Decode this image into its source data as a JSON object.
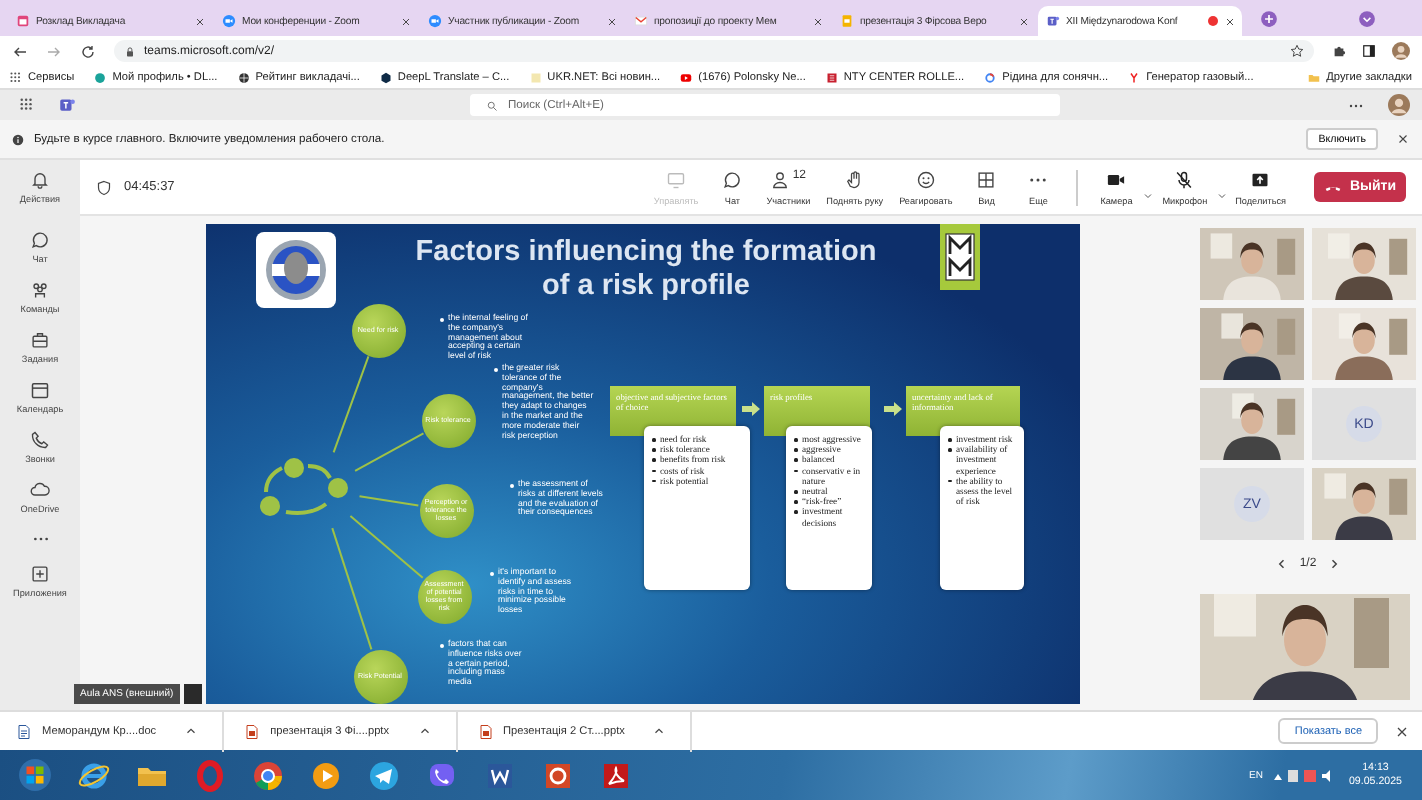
{
  "browser": {
    "tabs": [
      {
        "title": "Розклад Викладача",
        "kind": "calendar",
        "selected": false
      },
      {
        "title": "Мои конференции - Zoom",
        "kind": "zoom",
        "selected": false
      },
      {
        "title": "Участник публикации - Zoom",
        "kind": "zoom",
        "selected": false
      },
      {
        "title": "пропозиції до проекту Мем",
        "kind": "mail",
        "selected": false
      },
      {
        "title": "презентація 3 Фірсова Веро",
        "kind": "slides",
        "selected": false
      },
      {
        "title": "XII Międzynarodowa Konf",
        "kind": "teams",
        "selected": true
      }
    ],
    "url": "teams.microsoft.com/v2/",
    "bookmarks": [
      {
        "title": "Сервисы",
        "kind": "apps"
      },
      {
        "title": "Мой профиль • DL...",
        "kind": "profile"
      },
      {
        "title": "Рейтинг викладачі...",
        "kind": "globe"
      },
      {
        "title": "DeepL Translate – C...",
        "kind": "deepl"
      },
      {
        "title": "UKR.NET: Всі новин...",
        "kind": "ukrnet"
      },
      {
        "title": "(1676) Polonsky Ne...",
        "kind": "youtube"
      },
      {
        "title": "NTY CENTER ROLLE...",
        "kind": "nty"
      },
      {
        "title": "Рідина для сонячн...",
        "kind": "google"
      },
      {
        "title": "Генератор газовый...",
        "kind": "yandex"
      }
    ],
    "other_bookmarks": "Другие закладки"
  },
  "teams": {
    "search": {
      "placeholder": "Поиск (Ctrl+Alt+E)"
    }
  },
  "notice": {
    "text": "Будьте в курсе главного. Включите уведомления рабочего стола.",
    "button": "Включить"
  },
  "rail": [
    {
      "label": "Действия",
      "kind": "bell"
    },
    {
      "label": "Чат",
      "kind": "chat"
    },
    {
      "label": "Команды",
      "kind": "teams"
    },
    {
      "label": "Задания",
      "kind": "bag"
    },
    {
      "label": "Календарь",
      "kind": "calendar"
    },
    {
      "label": "Звонки",
      "kind": "phone"
    },
    {
      "label": "OneDrive",
      "kind": "cloud"
    },
    {
      "kind": "more"
    },
    {
      "label": "Приложения",
      "kind": "apps"
    }
  ],
  "meeting": {
    "timer": "04:45:37",
    "controls": [
      {
        "label": "Управлять",
        "kind": "manage",
        "disabled": true
      },
      {
        "label": "Чат",
        "kind": "chat",
        "disabled": false
      },
      {
        "label": "Участники",
        "kind": "people",
        "count": "12",
        "disabled": false
      },
      {
        "label": "Поднять руку",
        "kind": "hand",
        "disabled": false
      },
      {
        "label": "Реагировать",
        "kind": "react",
        "disabled": false
      },
      {
        "label": "Вид",
        "kind": "view",
        "disabled": false
      },
      {
        "label": "Еще",
        "kind": "more",
        "disabled": false
      },
      {
        "label": "Камера",
        "kind": "camera",
        "disabled": false
      },
      {
        "label": "Микрофон",
        "kind": "mic",
        "disabled": false
      },
      {
        "label": "Поделиться",
        "kind": "share",
        "disabled": false
      }
    ],
    "leave": "Выйти"
  },
  "slide": {
    "title_lines": [
      "Factors influencing the formation",
      "of a risk profile"
    ],
    "factors": [
      {
        "name": "Need for risk",
        "note": "the internal feeling of the company's management about accepting a certain level of risk"
      },
      {
        "name": "Risk tolerance",
        "note": "the greater risk tolerance of the company's management, the better they adapt to changes in the market and the more moderate their risk perception"
      },
      {
        "name": "Perception or tolerance the losses",
        "note": "the assessment of risks at different levels and the evaluation of their consequences"
      },
      {
        "name": "Assessment of potential losses from risk",
        "note": "it's important to identify and assess risks in time to minimize possible losses"
      },
      {
        "name": "Risk Potential",
        "note": "factors that can influence risks over a certain period, including mass media"
      }
    ],
    "steps": [
      {
        "header": "objective and subjective factors of choice",
        "items": [
          "need for risk",
          "risk tolerance",
          "benefits from risk",
          "costs of risk",
          "risk potential"
        ]
      },
      {
        "header": "risk profiles",
        "items": [
          "most aggressive",
          "aggressive",
          "balanced",
          "conservativ e in nature",
          "neutral",
          "“risk-free”",
          "investment decisions"
        ]
      },
      {
        "header": "uncertainty and lack of information",
        "items": [
          "investment risk",
          "availability of investment experience",
          "the ability to assess the level of risk"
        ]
      }
    ]
  },
  "presenter": "Aula ANS (внешний)",
  "participants": [
    {
      "kind": "picture"
    },
    {
      "kind": "picture"
    },
    {
      "kind": "picture"
    },
    {
      "kind": "picture"
    },
    {
      "kind": "picture"
    },
    {
      "kind": "avatar",
      "initials": "KD"
    },
    {
      "kind": "avatar",
      "initials": "ZV"
    },
    {
      "kind": "picture"
    }
  ],
  "pager": "1/2",
  "downloads": {
    "files": [
      {
        "name": "Меморандум Кр....doc",
        "kind": "doc"
      },
      {
        "name": "презентація 3 Фі....pptx",
        "kind": "pptx"
      },
      {
        "name": "Презентація 2 Ст....pptx",
        "kind": "pptx"
      }
    ],
    "show_all": "Показать все"
  },
  "taskbar": {
    "apps": [
      {
        "kind": "ie"
      },
      {
        "kind": "explorer"
      },
      {
        "kind": "opera"
      },
      {
        "kind": "chrome"
      },
      {
        "kind": "media"
      },
      {
        "kind": "telegram"
      },
      {
        "kind": "viber"
      },
      {
        "kind": "word"
      },
      {
        "kind": "powerpoint"
      },
      {
        "kind": "acrobat"
      }
    ],
    "lang": "EN",
    "time": "14:13",
    "date": "09.05.2025"
  }
}
